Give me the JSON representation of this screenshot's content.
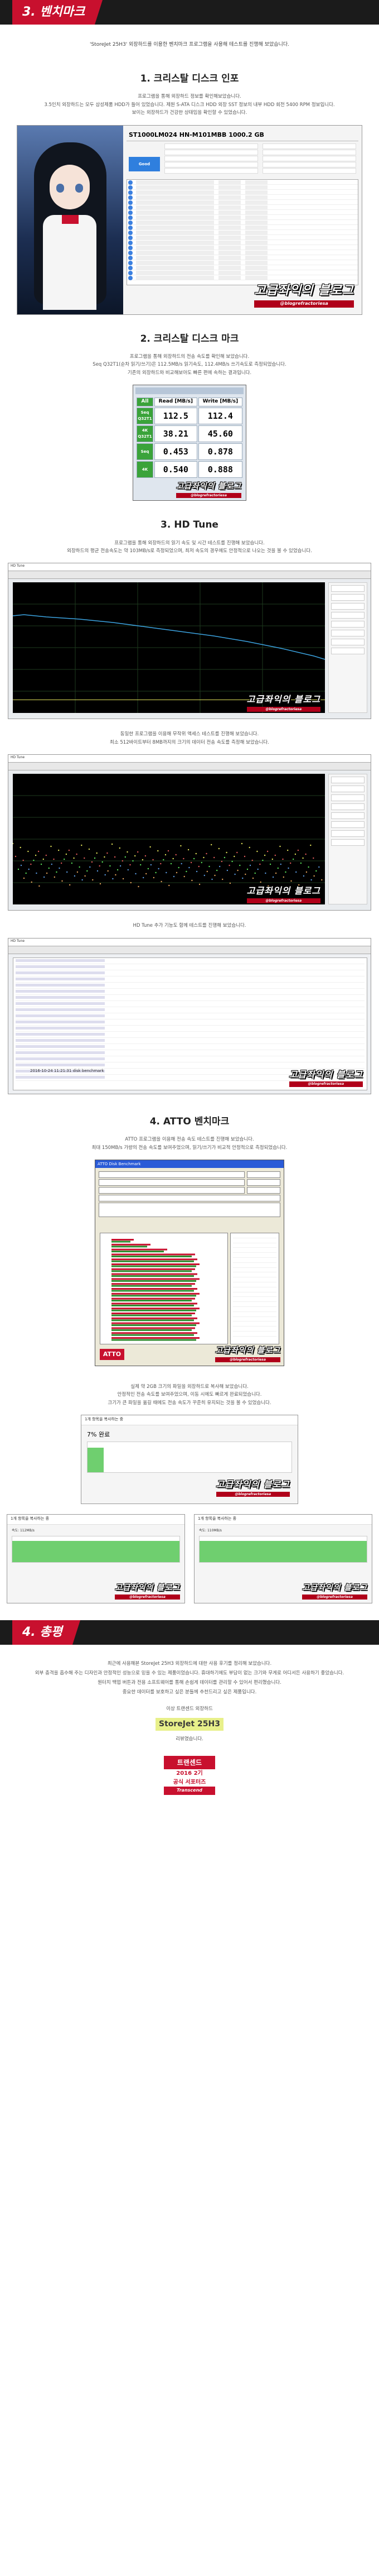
{
  "benchmark": {
    "section_label": "3. 벤치마크",
    "intro": "'StoreJet 25H3' 외장하드를 이용한 벤치마크 프로그램을 사용해 테스트를 진행해 보았습니다.",
    "cdi": {
      "title": "1. 크리스탈 디스크 인포",
      "lines": [
        "프로그램을 통해 외장하드 정보를 확인해보았습니다.",
        "3.5인치 외장하드는 모두 삼성제품 HDD가 들어 있었습니다. 제원 S-ATA 디스크 HDD 외장 SST 정보의 내부 HDD 회전 5400 RPM 정보입니다.",
        "보이는 외장하드가 건강한 상태임을 확인할 수 있었습니다."
      ],
      "model": "ST1000LM024 HN-M101MBB 1000.2 GB",
      "status": "Good",
      "watermark": "고급좌익의 블로그",
      "watermark_sub": "@blogrefractoriesa"
    },
    "cdm": {
      "title": "2. 크리스탈 디스크 마크",
      "lines": [
        "프로그램을 통해 외장하드의 전송 속도를 확인해 보았습니다.",
        "Seq Q32T1(순차 읽기/쓰기)은 112.5MB/s 읽기속도, 112.4MB/s 쓰기속도로 측정되었습니다.",
        "기존의 외장하드와 비교해보아도 빠른 편에 속하는 결과입니다."
      ],
      "header_read": "Read [MB/s]",
      "header_write": "Write [MB/s]",
      "all_button": "All",
      "rows": [
        {
          "label": "Seq Q32T1",
          "read": "112.5",
          "write": "112.4"
        },
        {
          "label": "4K Q32T1",
          "read": "38.21",
          "write": "45.60"
        },
        {
          "label": "Seq",
          "read": "0.453",
          "write": "0.878"
        },
        {
          "label": "4K",
          "read": "0.540",
          "write": "0.888"
        }
      ],
      "watermark": "고급좌익의 블로그",
      "watermark_sub": "@blogrefractoriesa"
    },
    "hdtune": {
      "title": "3. HD Tune",
      "lines": [
        "프로그램을 통해 외장하드의 읽기 속도 및 시간 테스트를 진행해 보았습니다.",
        "외장하드의 평균 전송속도는 약 103MB/s로 측정되었으며, 최저 속도의 경우에도 안정적으로 나오는 것을 볼 수 있었습니다."
      ],
      "lines2": [
        "동일한 프로그램을 이용해 무작위 액세스 테스트를 진행해 보았습니다.",
        "최소 512바이트부터 8MB까지의 크기의 데이터 전송 속도를 측정해 보았습니다."
      ],
      "lines3": "HD Tune 추가 기능도 함께 테스트를 진행해 보았습니다.",
      "tab_label": "HD Tune",
      "log_text": "2016-10-24 11:21:31 disk benchmark",
      "watermark": "고급좌익의 블로그",
      "watermark_sub": "@blogrefractoriesa"
    },
    "atto": {
      "title": "4. ATTO 벤치마크",
      "lines": [
        "ATTO 프로그램을 이용해 전송 속도 테스트를 진행해 보았습니다.",
        "최대 150MB/s 가량의 전송 속도를 보여주었으며, 읽기/쓰기가 비교적 안정적으로 측정되었습니다."
      ],
      "window_title": "ATTO Disk Benchmark",
      "badge": "ATTO",
      "watermark": "고급좌익의 블로그",
      "watermark_sub": "@blogrefractoriesa"
    },
    "copy_test": {
      "lines": [
        "실제 약 2GB 크기의 파일을 외장하드로 복사해 보았습니다.",
        "안정적인 전송 속도를 보여주었으며, 이동 시에도 빠르게 완료되었습니다.",
        "크기가 큰 파일을 옮길 때에도 전송 속도가 꾸준히 유지되는 것을 볼 수 있었습니다."
      ],
      "window_title": "1개 항목을 복사하는 중",
      "percent": "7% 완료",
      "speed_left": "속도: 112MB/s",
      "speed_right": "속도: 110MB/s",
      "watermark": "고급좌익의 블로그",
      "watermark_sub": "@blogrefractoriesa"
    }
  },
  "summary": {
    "section_label": "4. 총평",
    "paragraphs": [
      "최근에 사용해본 StoreJet 25H3 외장하드에 대한 사용 후기를 정리해 보았습니다.",
      "외부 충격을 흡수해 주는 디자인과 안정적인 성능으로 믿을 수 있는 제품이었습니다. 휴대하기에도 부담이 없는 크기와 무게로 어디서든 사용하기 좋았습니다.",
      "원터치 백업 버튼과 전용 소프트웨어를 통해 손쉽게 데이터를 관리할 수 있어서 편리했습니다.",
      "중요한 데이터를 보호하고 싶은 분들께 추천드리고 싶은 제품입니다."
    ],
    "closing": "이상 트랜센드 외장하드",
    "product_name": "StoreJet 25H3",
    "closing_tail": "리뷰였습니다."
  },
  "award": {
    "line1": "트랜센드",
    "line2": "2016 2기",
    "line3": "공식 서포터즈",
    "line4": "Transcend"
  }
}
